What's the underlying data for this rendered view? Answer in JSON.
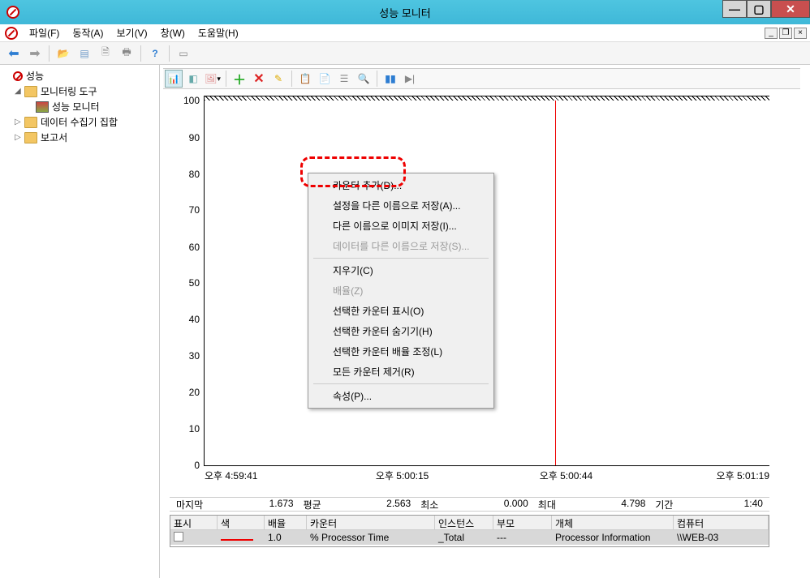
{
  "window": {
    "title": "성능 모니터"
  },
  "menu": {
    "file": "파일(F)",
    "action": "동작(A)",
    "view": "보기(V)",
    "window": "창(W)",
    "help": "도움말(H)"
  },
  "tree": {
    "root": "성능",
    "monitoring_tools": "모니터링 도구",
    "perf_monitor": "성능 모니터",
    "data_collector": "데이터 수집기 집합",
    "reports": "보고서"
  },
  "context_menu": {
    "add_counter": "카운터 추가(D)...",
    "save_settings_as": "설정을 다른 이름으로 저장(A)...",
    "save_image_as": "다른 이름으로 이미지 저장(I)...",
    "save_data_as": "데이터를 다른 이름으로 저장(S)...",
    "clear": "지우기(C)",
    "scale": "배율(Z)",
    "show_selected": "선택한 카운터 표시(O)",
    "hide_selected": "선택한 카운터 숨기기(H)",
    "adjust_scale": "선택한 카운터 배율 조정(L)",
    "remove_all": "모든 카운터 제거(R)",
    "properties": "속성(P)..."
  },
  "chart_data": {
    "type": "line",
    "y_ticks": [
      "100",
      "90",
      "80",
      "70",
      "60",
      "50",
      "40",
      "30",
      "20",
      "10",
      "0"
    ],
    "x_ticks": [
      "오후 4:59:41",
      "오후 5:00:15",
      "오후 5:00:44",
      "오후 5:01:19"
    ],
    "ylim": [
      0,
      100
    ],
    "title": "",
    "xlabel": "",
    "ylabel": "",
    "series": [
      {
        "name": "% Processor Time",
        "color": "#e00000"
      }
    ],
    "cursor_x_fraction": 0.62
  },
  "stats": {
    "last_label": "마지막",
    "last_value": "1.673",
    "avg_label": "평균",
    "avg_value": "2.563",
    "min_label": "최소",
    "min_value": "0.000",
    "max_label": "최대",
    "max_value": "4.798",
    "duration_label": "기간",
    "duration_value": "1:40"
  },
  "grid": {
    "headers": {
      "show": "표시",
      "color": "색",
      "scale": "배율",
      "counter": "카운터",
      "instance": "인스턴스",
      "parent": "부모",
      "object": "개체",
      "computer": "컴퓨터"
    },
    "rows": [
      {
        "show": true,
        "color": "#e00000",
        "scale": "1.0",
        "counter": "% Processor Time",
        "instance": "_Total",
        "parent": "---",
        "object": "Processor Information",
        "computer": "\\\\WEB-03"
      }
    ]
  }
}
